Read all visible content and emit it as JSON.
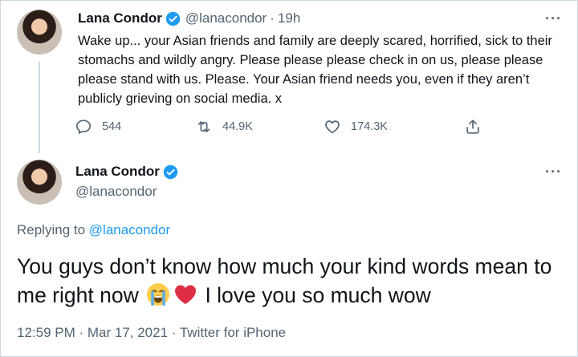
{
  "tweet1": {
    "name": "Lana Condor",
    "handle": "@lanacondor",
    "separator": "·",
    "time": "19h",
    "text": "Wake up... your Asian friends and family are deeply scared, horrified, sick to their stomachs and wildly angry. Please please please check in on us, please please please stand with us. Please. Your Asian friend needs you, even if they aren’t publicly grieving on social media. x",
    "replies": "544",
    "retweets": "44.9K",
    "likes": "174.3K",
    "more": "···"
  },
  "tweet2": {
    "name": "Lana Condor",
    "handle": "@lanacondor",
    "more": "···",
    "replying_prefix": "Replying to",
    "replying_handle": "@lanacondor",
    "text_before": "You guys don’t know how much your kind words mean to me right now",
    "text_after": " I love you so much wow",
    "emojis": [
      "loudly-crying-face-emoji",
      "red-heart-emoji"
    ],
    "timestamp": "12:59 PM · Mar 17, 2021 · Twitter for iPhone"
  },
  "colors": {
    "text": "#0f1419",
    "secondary": "#536471",
    "accent": "#1d9bf0",
    "heart": "#e0245e",
    "thread_line": "#cfd9de"
  }
}
